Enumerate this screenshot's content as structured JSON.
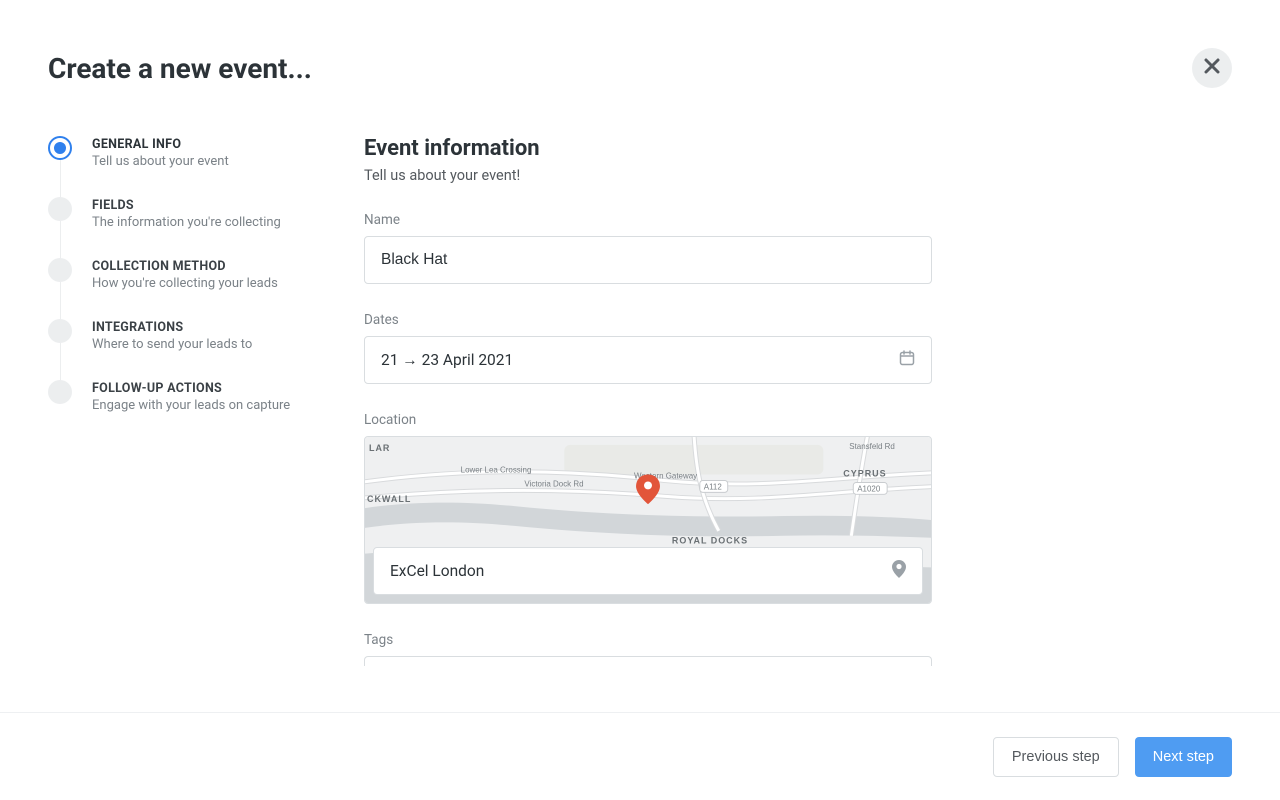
{
  "header": {
    "title": "Create a new event..."
  },
  "stepper": {
    "steps": [
      {
        "title": "GENERAL INFO",
        "sub": "Tell us about your event"
      },
      {
        "title": "FIELDS",
        "sub": "The information you're collecting"
      },
      {
        "title": "COLLECTION METHOD",
        "sub": "How you're collecting your leads"
      },
      {
        "title": "INTEGRATIONS",
        "sub": "Where to send your leads to"
      },
      {
        "title": "FOLLOW-UP ACTIONS",
        "sub": "Engage with your leads on capture"
      }
    ]
  },
  "form": {
    "section_title": "Event information",
    "section_sub": "Tell us about your event!",
    "name": {
      "label": "Name",
      "value": "Black Hat"
    },
    "dates": {
      "label": "Dates",
      "value": "21 → 23 April 2021"
    },
    "location": {
      "label": "Location",
      "value": "ExCel London"
    },
    "tags": {
      "label": "Tags"
    }
  },
  "map": {
    "labels": {
      "blackwall": "CKWALL",
      "lar": "LAR",
      "royal_docks": "ROYAL DOCKS",
      "cyprus": "CYPRUS",
      "road_lowerlea": "Lower Lea Crossing",
      "road_victoria": "Victoria Dock Rd",
      "road_a112": "A112",
      "road_a1020": "A1020",
      "road_stansfeld": "Stansfeld Rd",
      "road_western": "Western Gateway"
    }
  },
  "footer": {
    "prev": "Previous step",
    "next": "Next step"
  }
}
